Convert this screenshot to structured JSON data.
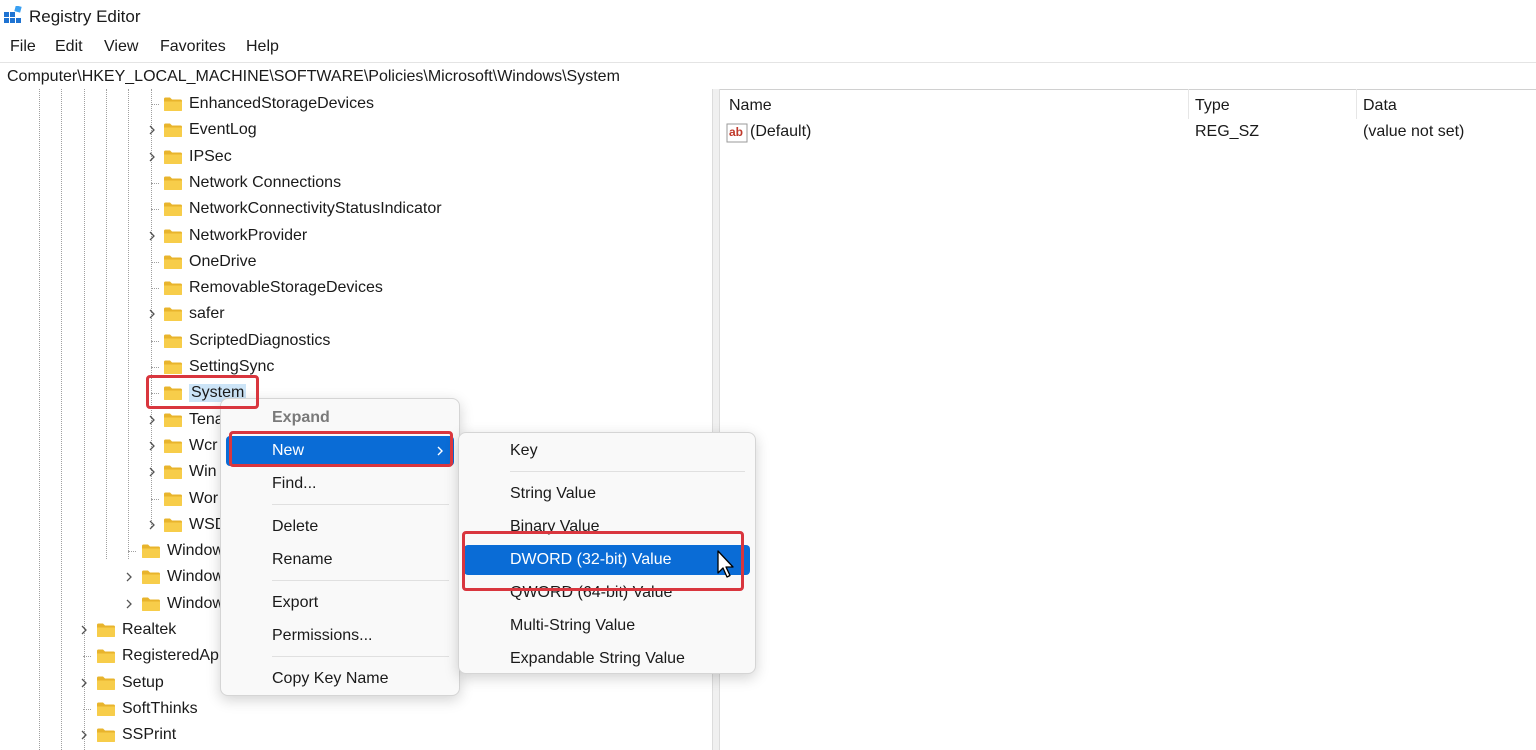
{
  "window": {
    "title": "Registry Editor"
  },
  "menubar": [
    "File",
    "Edit",
    "View",
    "Favorites",
    "Help"
  ],
  "address": "Computer\\HKEY_LOCAL_MACHINE\\SOFTWARE\\Policies\\Microsoft\\Windows\\System",
  "tree": {
    "level3": [
      {
        "label": "EnhancedStorageDevices",
        "expandable": false
      },
      {
        "label": "EventLog",
        "expandable": true
      },
      {
        "label": "IPSec",
        "expandable": true
      },
      {
        "label": "Network Connections",
        "expandable": false
      },
      {
        "label": "NetworkConnectivityStatusIndicator",
        "expandable": false
      },
      {
        "label": "NetworkProvider",
        "expandable": true
      },
      {
        "label": "OneDrive",
        "expandable": false
      },
      {
        "label": "RemovableStorageDevices",
        "expandable": false
      },
      {
        "label": "safer",
        "expandable": true
      },
      {
        "label": "ScriptedDiagnostics",
        "expandable": false
      },
      {
        "label": "SettingSync",
        "expandable": false
      },
      {
        "label": "System",
        "expandable": false,
        "selected": true
      },
      {
        "label": "Tena",
        "expandable": true
      },
      {
        "label": "Wcr",
        "expandable": true
      },
      {
        "label": "Win",
        "expandable": true
      },
      {
        "label": "Wor",
        "expandable": false
      },
      {
        "label": "WSD",
        "expandable": true
      }
    ],
    "level2": [
      {
        "label": "Window",
        "expandable": false
      },
      {
        "label": "Window",
        "expandable": true
      },
      {
        "label": "Window",
        "expandable": true
      }
    ],
    "level1": [
      {
        "label": "Realtek",
        "expandable": true
      },
      {
        "label": "RegisteredAp",
        "expandable": false
      },
      {
        "label": "Setup",
        "expandable": true
      },
      {
        "label": "SoftThinks",
        "expandable": false
      },
      {
        "label": "SSPrint",
        "expandable": true
      }
    ]
  },
  "values": {
    "headers": {
      "name": "Name",
      "type": "Type",
      "data": "Data"
    },
    "rows": [
      {
        "name": "(Default)",
        "type": "REG_SZ",
        "data": "(value not set)"
      }
    ]
  },
  "context_menu": {
    "expand": "Expand",
    "new": "New",
    "find": "Find...",
    "delete": "Delete",
    "rename": "Rename",
    "export": "Export",
    "permissions": "Permissions...",
    "copy_key_name": "Copy Key Name"
  },
  "submenu": {
    "key": "Key",
    "string_value": "String Value",
    "binary_value": "Binary Value",
    "dword_value": "DWORD (32-bit) Value",
    "qword_value": "QWORD (64-bit) Value",
    "multi_string_value": "Multi-String Value",
    "expandable_string_value": "Expandable String Value"
  },
  "colors": {
    "highlight": "#0a6cd6",
    "selection": "#cce4f7",
    "annotation_red": "#d9363e",
    "folder_yellow": "#f4c542"
  }
}
